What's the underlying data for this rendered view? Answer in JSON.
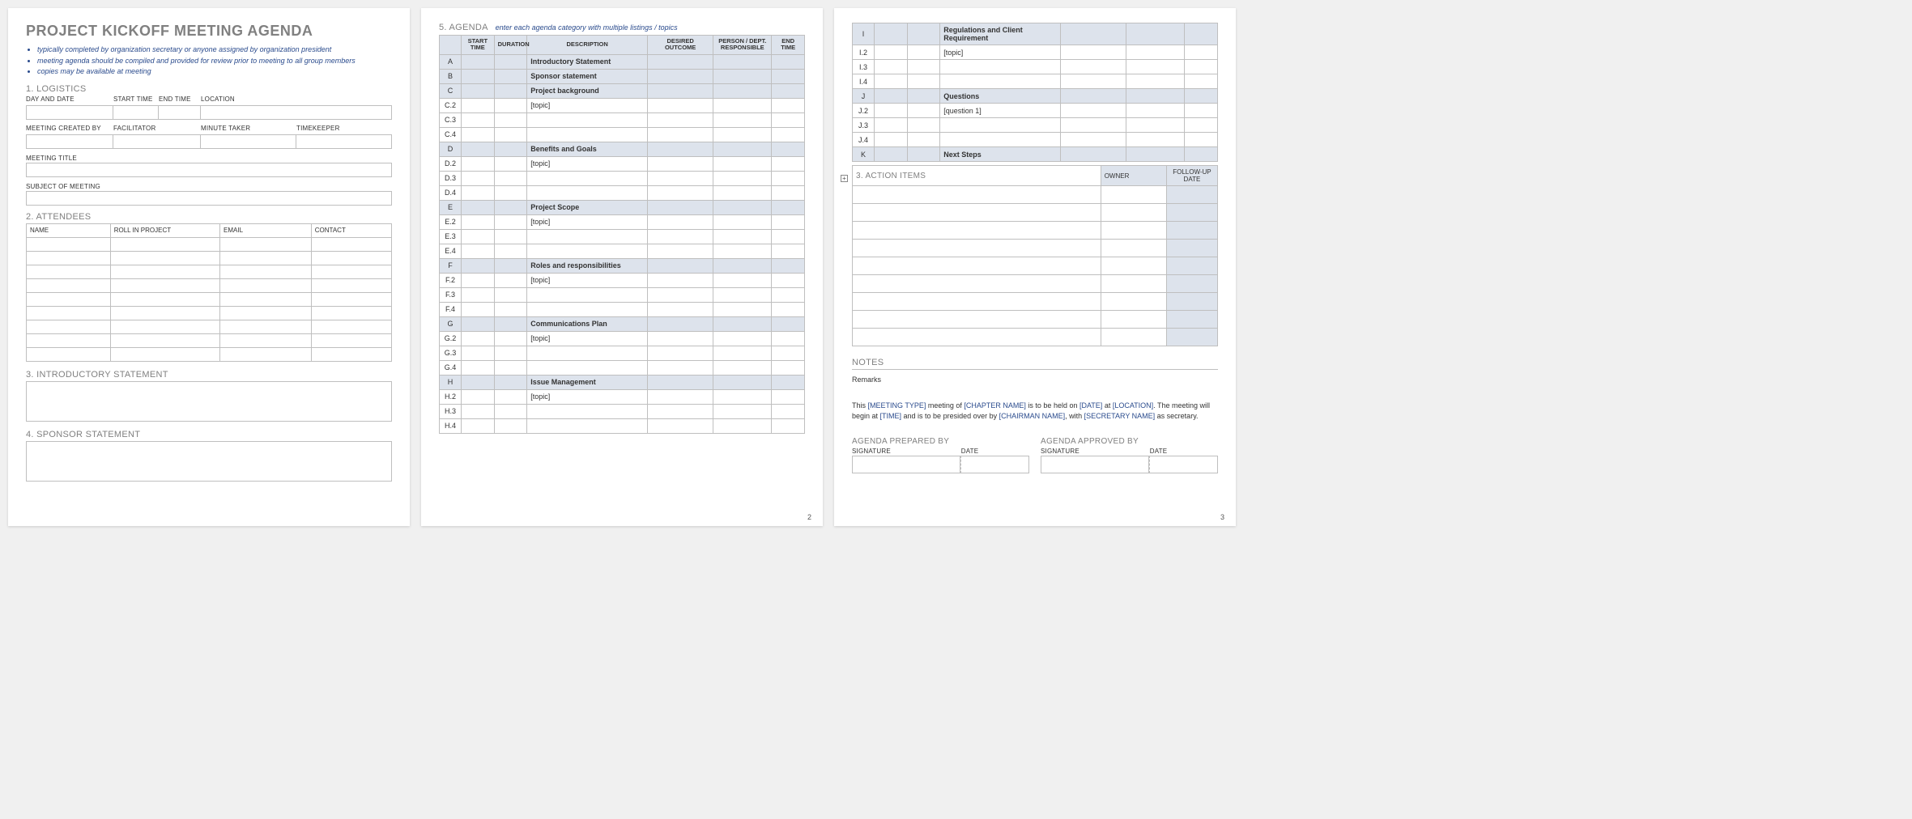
{
  "title": "PROJECT KICKOFF MEETING AGENDA",
  "bullets": [
    "typically completed by organization secretary or anyone assigned by organization president",
    "meeting agenda should be compiled and provided for review prior to meeting to all group members",
    "copies may be available at meeting"
  ],
  "sections": {
    "s1": "1. LOGISTICS",
    "s2": "2. ATTENDEES",
    "s3": "3. INTRODUCTORY STATEMENT",
    "s4": "4. SPONSOR STATEMENT",
    "s5": "5. AGENDA",
    "s5hint": "enter each agenda category with multiple listings / topics",
    "s6": "3. ACTION ITEMS",
    "notes": "NOTES",
    "prepared": "AGENDA PREPARED BY",
    "approved": "AGENDA APPROVED BY"
  },
  "logistics_labels": {
    "day": "DAY AND DATE",
    "start": "START TIME",
    "end": "END TIME",
    "loc": "LOCATION",
    "created": "MEETING CREATED BY",
    "fac": "FACILITATOR",
    "min": "MINUTE TAKER",
    "time": "TIMEKEEPER",
    "title": "MEETING TITLE",
    "subject": "SUBJECT OF MEETING"
  },
  "attendees_headers": {
    "name": "NAME",
    "role": "ROLL IN PROJECT",
    "email": "EMAIL",
    "contact": "CONTACT"
  },
  "agenda_headers": {
    "start": "START TIME",
    "dur": "DURATION",
    "desc": "DESCRIPTION",
    "out": "DESIRED OUTCOME",
    "resp": "PERSON / DEPT. RESPONSIBLE",
    "end": "END TIME"
  },
  "agenda_rows_p2": [
    {
      "id": "A",
      "major": true,
      "desc": "Introductory Statement"
    },
    {
      "id": "B",
      "major": true,
      "desc": "Sponsor statement"
    },
    {
      "id": "C",
      "major": true,
      "desc": "Project background"
    },
    {
      "id": "C.2",
      "major": false,
      "desc": "[topic]"
    },
    {
      "id": "C.3",
      "major": false,
      "desc": ""
    },
    {
      "id": "C.4",
      "major": false,
      "desc": ""
    },
    {
      "id": "D",
      "major": true,
      "desc": "Benefits and Goals"
    },
    {
      "id": "D.2",
      "major": false,
      "desc": "[topic]"
    },
    {
      "id": "D.3",
      "major": false,
      "desc": ""
    },
    {
      "id": "D.4",
      "major": false,
      "desc": ""
    },
    {
      "id": "E",
      "major": true,
      "desc": "Project Scope"
    },
    {
      "id": "E.2",
      "major": false,
      "desc": "[topic]"
    },
    {
      "id": "E.3",
      "major": false,
      "desc": ""
    },
    {
      "id": "E.4",
      "major": false,
      "desc": ""
    },
    {
      "id": "F",
      "major": true,
      "desc": "Roles and responsibilities"
    },
    {
      "id": "F.2",
      "major": false,
      "desc": "[topic]"
    },
    {
      "id": "F.3",
      "major": false,
      "desc": ""
    },
    {
      "id": "F.4",
      "major": false,
      "desc": ""
    },
    {
      "id": "G",
      "major": true,
      "desc": "Communications Plan"
    },
    {
      "id": "G.2",
      "major": false,
      "desc": "[topic]"
    },
    {
      "id": "G.3",
      "major": false,
      "desc": ""
    },
    {
      "id": "G.4",
      "major": false,
      "desc": ""
    },
    {
      "id": "H",
      "major": true,
      "desc": "Issue Management"
    },
    {
      "id": "H.2",
      "major": false,
      "desc": "[topic]"
    },
    {
      "id": "H.3",
      "major": false,
      "desc": ""
    },
    {
      "id": "H.4",
      "major": false,
      "desc": ""
    }
  ],
  "agenda_rows_p3": [
    {
      "id": "I",
      "major": true,
      "desc": "Regulations and Client Requirement"
    },
    {
      "id": "I.2",
      "major": false,
      "desc": "[topic]"
    },
    {
      "id": "I.3",
      "major": false,
      "desc": ""
    },
    {
      "id": "I.4",
      "major": false,
      "desc": ""
    },
    {
      "id": "J",
      "major": true,
      "desc": "Questions"
    },
    {
      "id": "J.2",
      "major": false,
      "desc": "[question 1]"
    },
    {
      "id": "J.3",
      "major": false,
      "desc": ""
    },
    {
      "id": "J.4",
      "major": false,
      "desc": ""
    },
    {
      "id": "K",
      "major": true,
      "desc": "Next Steps"
    }
  ],
  "action_headers": {
    "owner": "OWNER",
    "fu": "FOLLOW-UP DATE"
  },
  "notes": {
    "remarks": "Remarks",
    "text_parts": {
      "t1": "This ",
      "p1": "[MEETING TYPE]",
      "t2": " meeting of ",
      "p2": "[CHAPTER NAME]",
      "t3": " is to be held on ",
      "p3": "[DATE]",
      "t4": " at ",
      "p4": "[LOCATION]",
      "t5": ".  The meeting will begin at ",
      "p5": "[TIME]",
      "t6": " and is to be presided over by ",
      "p6": "[CHAIRMAN NAME]",
      "t7": ", with ",
      "p7": "[SECRETARY NAME]",
      "t8": " as secretary."
    }
  },
  "sig_labels": {
    "sig": "SIGNATURE",
    "date": "DATE"
  },
  "page_nums": {
    "p2": "2",
    "p3": "3"
  },
  "expand": "+"
}
